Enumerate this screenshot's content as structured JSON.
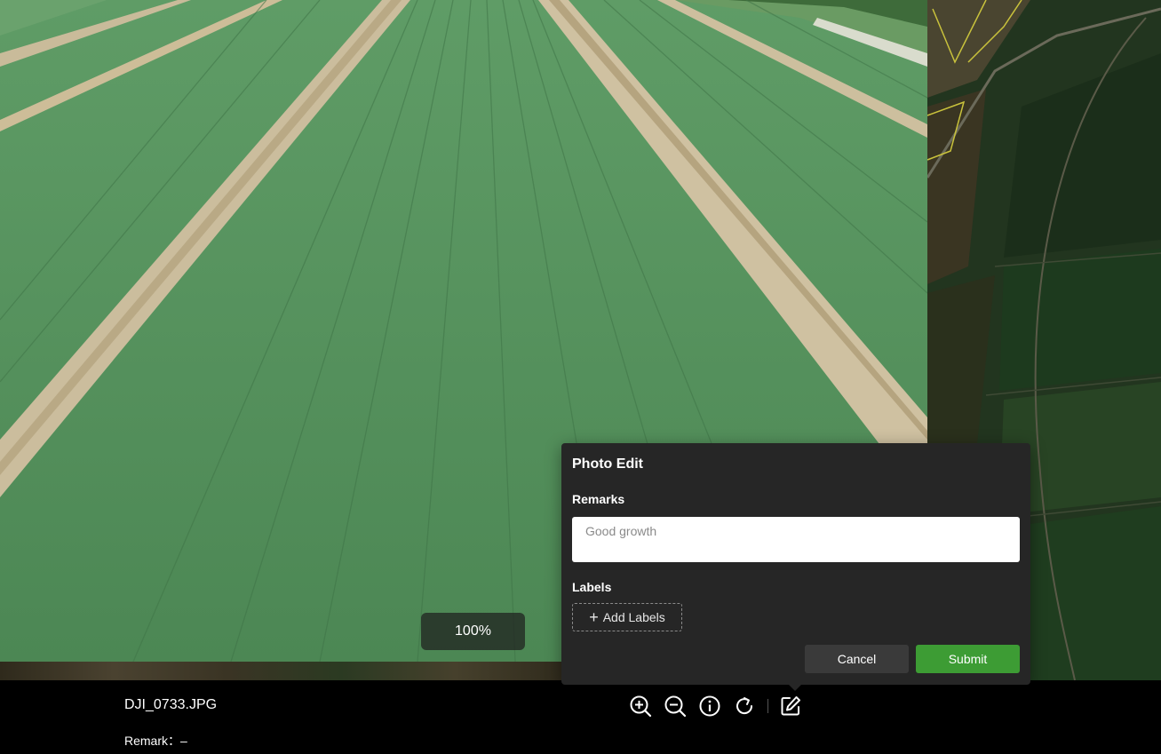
{
  "viewer": {
    "zoom_level": "100%",
    "filename": "DJI_0733.JPG",
    "remark_line": "Remark：–"
  },
  "toolbar": {
    "icons": [
      "zoom-in-icon",
      "zoom-out-icon",
      "info-icon",
      "rotate-icon",
      "edit-icon"
    ]
  },
  "dialog": {
    "title": "Photo Edit",
    "remarks_label": "Remarks",
    "remarks_value": "Good growth",
    "labels_label": "Labels",
    "add_labels_text": "Add Labels",
    "cancel_label": "Cancel",
    "submit_label": "Submit"
  },
  "colors": {
    "submit_accent": "#3d9c34",
    "dialog_bg": "#262626",
    "bottom_bar_bg": "#000000"
  }
}
